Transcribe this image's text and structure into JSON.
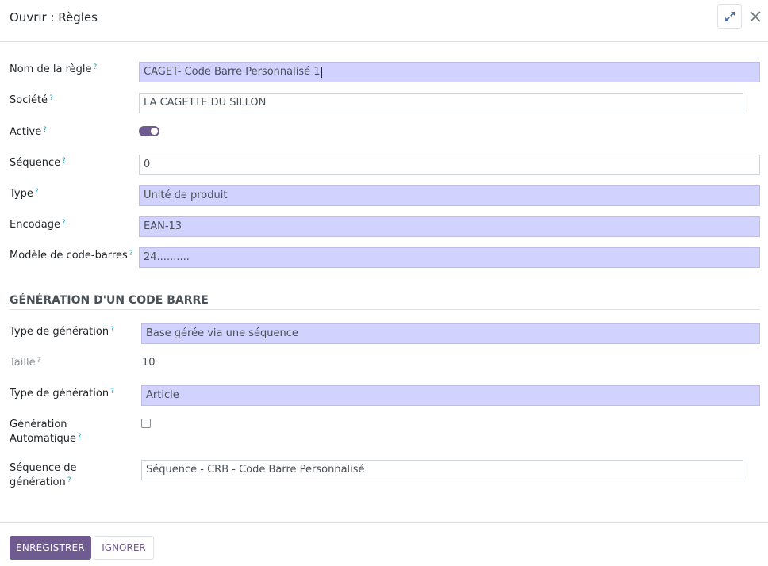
{
  "dialog": {
    "title": "Ouvrir : Règles",
    "expand_icon": "expand-arrows-icon",
    "close_icon": "close-icon"
  },
  "form": {
    "rule_name": {
      "label": "Nom de la règle",
      "value": "CAGET- Code Barre Personnalisé 1"
    },
    "company": {
      "label": "Société",
      "value": "LA CAGETTE DU SILLON"
    },
    "active": {
      "label": "Active",
      "checked": true
    },
    "sequence": {
      "label": "Séquence",
      "value": "0"
    },
    "type": {
      "label": "Type",
      "value": "Unité de produit"
    },
    "encoding": {
      "label": "Encodage",
      "value": "EAN-13"
    },
    "barcode_pattern": {
      "label": "Modèle de code-barres",
      "value": "24.........."
    }
  },
  "generation": {
    "section_title": "GÉNÉRATION D'UN CODE BARRE",
    "generation_type": {
      "label": "Type de génération",
      "value": "Base gérée via une séquence"
    },
    "size": {
      "label": "Taille",
      "value": "10"
    },
    "generation_type_2": {
      "label": "Type de génération",
      "value": "Article"
    },
    "auto_generation": {
      "label_line1": "Génération",
      "label_line2": "Automatique",
      "checked": false
    },
    "generation_sequence": {
      "label_line1": "Séquence de",
      "label_line2": "génération",
      "value": "Séquence - CRB - Code Barre Personnalisé"
    }
  },
  "help_marker": "?",
  "footer": {
    "save_label": "ENREGISTRER",
    "cancel_label": "IGNORER"
  },
  "colors": {
    "primary": "#6f5b8f",
    "required_bg": "#d2d2ff",
    "help": "#17a2b8"
  }
}
